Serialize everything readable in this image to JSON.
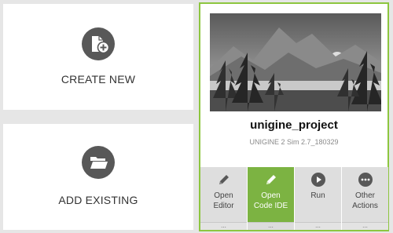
{
  "tiles": {
    "create_new": {
      "label": "CREATE NEW",
      "icon": "new-file-icon"
    },
    "add_existing": {
      "label": "ADD EXISTING",
      "icon": "open-folder-icon"
    }
  },
  "project": {
    "name": "unigine_project",
    "subtitle": "UNIGINE 2 Sim 2.7_180329",
    "thumbnail_icon": "mountain-landscape-thumbnail",
    "accent_color": "#8dc63f"
  },
  "actions": [
    {
      "label": "Open\nEditor",
      "icon": "pencil-icon",
      "more": "...",
      "active": false
    },
    {
      "label": "Open\nCode IDE",
      "icon": "pencil-icon",
      "more": "...",
      "active": true
    },
    {
      "label": "Run",
      "icon": "play-icon",
      "more": "...",
      "active": false
    },
    {
      "label": "Other\nActions",
      "icon": "more-dots-icon",
      "more": "...",
      "active": false
    }
  ]
}
